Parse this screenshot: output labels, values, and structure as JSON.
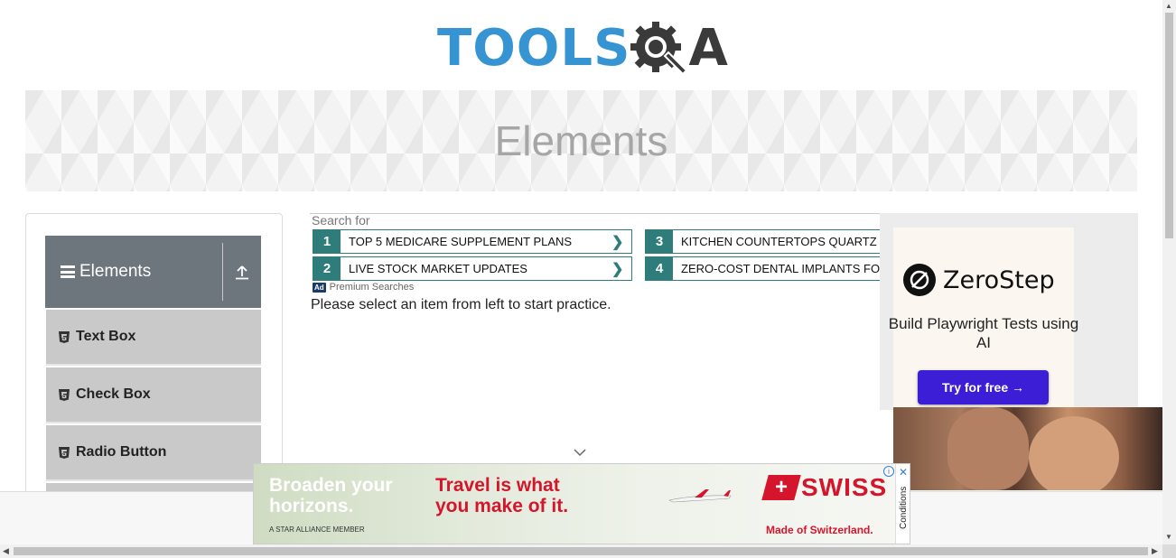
{
  "logo": {
    "part1": "TOOLS",
    "part2": "A"
  },
  "banner": {
    "title": "Elements"
  },
  "sidebar": {
    "group": {
      "label": "Elements"
    },
    "items": [
      {
        "label": "Text Box"
      },
      {
        "label": "Check Box"
      },
      {
        "label": "Radio Button"
      }
    ]
  },
  "search_ads": {
    "header": "Search for",
    "items": [
      {
        "num": "1",
        "text": "TOP 5 MEDICARE SUPPLEMENT PLANS"
      },
      {
        "num": "2",
        "text": "LIVE STOCK MARKET UPDATES"
      },
      {
        "num": "3",
        "text": "KITCHEN COUNTERTOPS QUARTZ"
      },
      {
        "num": "4",
        "text": "ZERO-COST DENTAL IMPLANTS FOR I"
      }
    ],
    "ad_badge": "Ad",
    "provider": "Premium Searches",
    "arrow": "❯"
  },
  "main": {
    "message": "Please select an item from left to start practice."
  },
  "zerostep_ad": {
    "brand": "ZeroStep",
    "tagline": "Build Playwright Tests using AI",
    "cta": "Try for free →"
  },
  "swiss_ad": {
    "headline1": "Broaden your horizons.",
    "headline2": "Travel is what you make of it.",
    "alliance": "A STAR ALLIANCE MEMBER",
    "brand": "SWISS",
    "tagline": "Made of Switzerland.",
    "conditions": "Conditions"
  },
  "colors": {
    "accent_teal": "#2f7d7a",
    "logo_blue": "#3794d2",
    "swiss_red": "#d4152b",
    "zerostep_button": "#3b1ed6",
    "sidebar_header": "#6d757d"
  }
}
